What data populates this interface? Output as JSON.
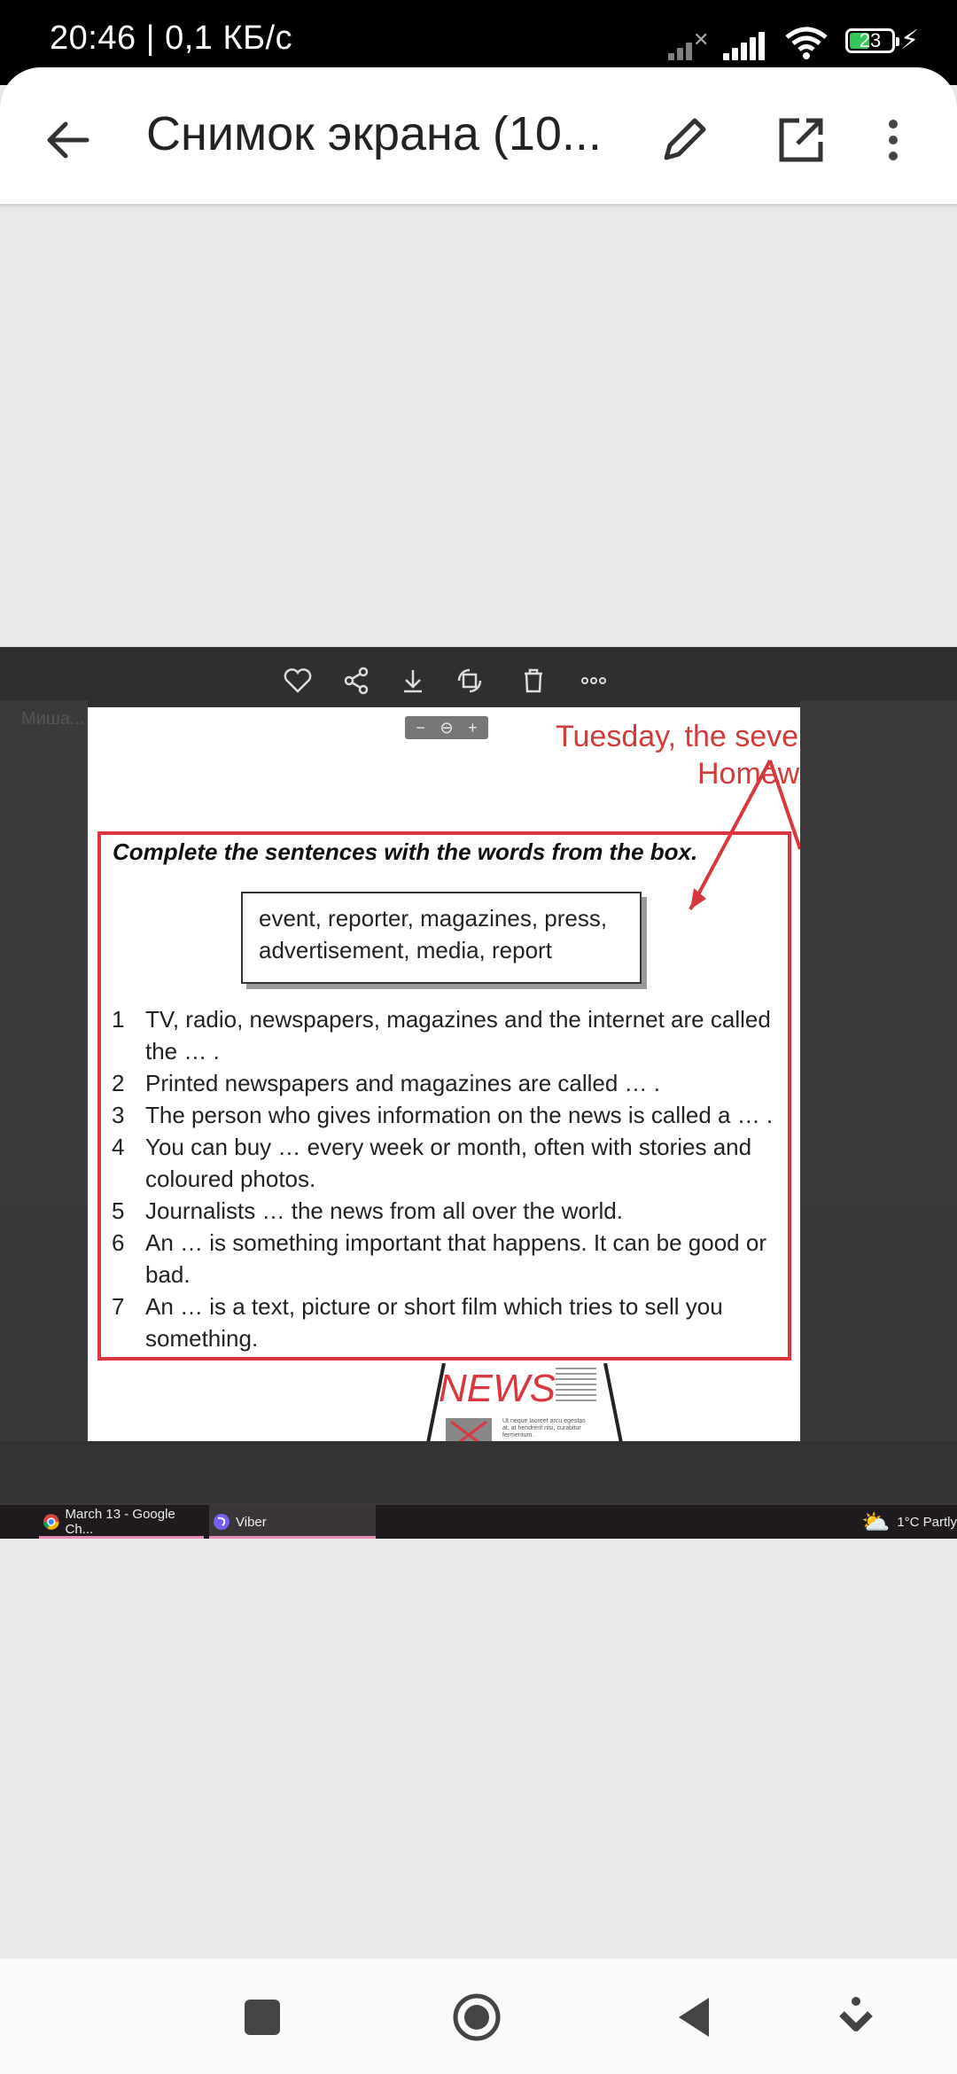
{
  "status_bar": {
    "time": "20:46 | 0,1 КБ/с",
    "battery": "23"
  },
  "toolbar": {
    "title": "Снимок экрана (10..."
  },
  "photo": {
    "blurred_name": "Миша...",
    "zoom": {
      "minus": "−",
      "plus": "+"
    },
    "header_line1": "Tuesday, the seve",
    "header_line2": "Homew",
    "instruction": "Complete the sentences with the words from the box.",
    "word_box": {
      "line1": "event, reporter, magazines, press,",
      "line2": "advertisement, media, report"
    },
    "items": [
      {
        "num": "1",
        "text": "TV, radio, newspapers, magazines and the internet are called the … ."
      },
      {
        "num": "2",
        "text": "Printed newspapers and magazines are called … ."
      },
      {
        "num": "3",
        "text": "The person who gives information on the news is called a … ."
      },
      {
        "num": "4",
        "text": "You can buy … every week or month, often with stories and coloured photos."
      },
      {
        "num": "5",
        "text": "Journalists … the news from all over the world."
      },
      {
        "num": "6",
        "text": "An … is something important that happens. It can be good or bad."
      },
      {
        "num": "7",
        "text": "An … is a text, picture or short film which tries to sell you something."
      }
    ],
    "news_label": "NEWS",
    "news_text": "Ut neque laoreet arcu egestas at, at hendrerit nisi, curabitur fermentum."
  },
  "taskbar": {
    "chrome": "March 13 - Google Ch...",
    "viber": "Viber",
    "weather": "1°C  Partly"
  },
  "colors": {
    "accent_red": "#d9373d",
    "battery_green": "#34c759",
    "taskbar_active": "#e889b6"
  }
}
